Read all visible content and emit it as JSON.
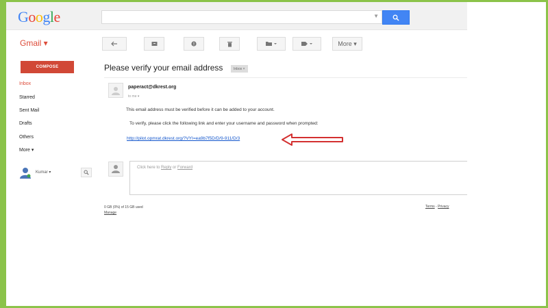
{
  "header": {
    "logo_letters": [
      "G",
      "o",
      "o",
      "g",
      "l",
      "e"
    ],
    "search_icon": "search-icon"
  },
  "toolbar": {
    "gmail_label": "Gmail ▾",
    "more_label": "More ▾",
    "buttons": [
      "back-icon",
      "archive-icon",
      "report-spam-icon",
      "delete-icon",
      "move-to-folder-icon",
      "labels-icon"
    ]
  },
  "sidebar": {
    "compose_label": "COMPOSE",
    "items": [
      {
        "label": "Inbox",
        "active": true
      },
      {
        "label": "Starred",
        "active": false
      },
      {
        "label": "Sent Mail",
        "active": false
      },
      {
        "label": "Drafts",
        "active": false
      },
      {
        "label": "Others",
        "active": false
      },
      {
        "label": "More ▾",
        "active": false
      }
    ],
    "profile_name": "Kumar ▾"
  },
  "email": {
    "subject": "Please verify your email address",
    "label_badge": "Inbox ×",
    "sender": "paperact@dkrest.org",
    "to": "to me ▾",
    "body_line1": "This email address must be verified before it can be added to your account.",
    "body_line2": "To verify, please click the following link and enter your username and password when prompted:",
    "verify_link": "http://pilot.opmrat.dkrest.org/?VYI=ea9b7f5D/D/9-911/D/3"
  },
  "reply": {
    "prefix": "Click here to ",
    "reply_link": "Reply",
    "or": " or ",
    "forward_link": "Forward"
  },
  "footer": {
    "storage": "0 GB (0%) of 15 GB used",
    "manage": "Manage",
    "terms": "Terms",
    "sep": " - ",
    "privacy": "Privacy"
  },
  "colors": {
    "frame": "#8bc34a",
    "compose": "#d14836",
    "arrow": "#d32f2f",
    "link": "#1155cc"
  }
}
